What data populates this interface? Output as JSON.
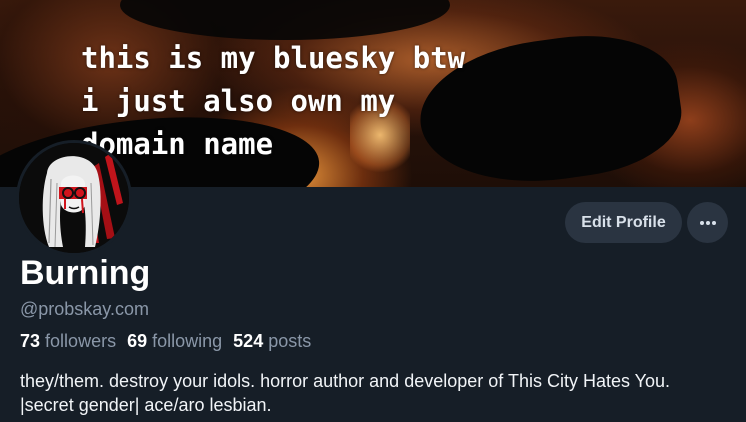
{
  "banner": {
    "caption": "this is my bluesky btw\ni just also own my\ndomain name"
  },
  "profile": {
    "display_name": "Burning",
    "handle": "@probskay.com",
    "edit_profile_label": "Edit Profile",
    "more_icon": "ellipsis-icon",
    "bio": "they/them. destroy your idols. horror author and developer of This City Hates You. |secret gender| ace/aro lesbian."
  },
  "stats": {
    "followers_count": "73",
    "followers_label": "followers",
    "following_count": "69",
    "following_label": "following",
    "posts_count": "524",
    "posts_label": "posts"
  },
  "colors": {
    "background": "#161e27",
    "button_bg": "#2a3441",
    "muted_text": "#8a97a8",
    "text": "#ffffff"
  }
}
